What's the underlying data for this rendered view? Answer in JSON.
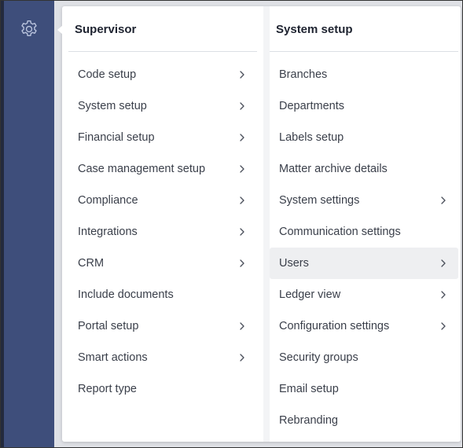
{
  "colors": {
    "sidebar": "#3e4e7b",
    "panel": "#ffffff",
    "active_item": "#eeeff1",
    "text": "#3a3f4a"
  },
  "sidebar": {
    "icon": "gear-icon"
  },
  "supervisor": {
    "title": "Supervisor",
    "items": [
      {
        "label": "Code setup",
        "has_submenu": true
      },
      {
        "label": "System setup",
        "has_submenu": true
      },
      {
        "label": "Financial setup",
        "has_submenu": true
      },
      {
        "label": "Case management setup",
        "has_submenu": true
      },
      {
        "label": "Compliance",
        "has_submenu": true
      },
      {
        "label": "Integrations",
        "has_submenu": true
      },
      {
        "label": "CRM",
        "has_submenu": true
      },
      {
        "label": "Include documents",
        "has_submenu": false
      },
      {
        "label": "Portal setup",
        "has_submenu": true
      },
      {
        "label": "Smart actions",
        "has_submenu": true
      },
      {
        "label": "Report type",
        "has_submenu": false
      }
    ]
  },
  "system_setup": {
    "title": "System setup",
    "items": [
      {
        "label": "Branches",
        "has_submenu": false
      },
      {
        "label": "Departments",
        "has_submenu": false
      },
      {
        "label": "Labels setup",
        "has_submenu": false
      },
      {
        "label": "Matter archive details",
        "has_submenu": false
      },
      {
        "label": "System settings",
        "has_submenu": true
      },
      {
        "label": "Communication settings",
        "has_submenu": false
      },
      {
        "label": "Users",
        "has_submenu": true,
        "active": true
      },
      {
        "label": "Ledger view",
        "has_submenu": true
      },
      {
        "label": "Configuration settings",
        "has_submenu": true
      },
      {
        "label": "Security groups",
        "has_submenu": false
      },
      {
        "label": "Email setup",
        "has_submenu": false
      },
      {
        "label": "Rebranding",
        "has_submenu": false
      }
    ]
  }
}
